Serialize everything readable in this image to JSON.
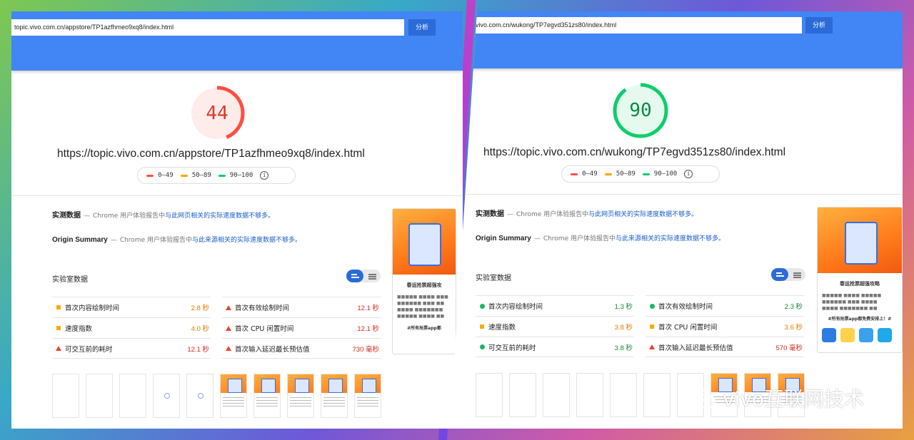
{
  "left": {
    "url_input": "topic.vivo.com.cn/appstore/TP1azfhmeo9xq8/index.html",
    "analyze_label": "分析",
    "score": "44",
    "score_color": "#ff4e42",
    "page_url": "https://topic.vivo.com.cn/appstore/TP1azfhmeo9xq8/index.html",
    "field_title": "实测数据",
    "field_dash": "—",
    "field_desc": "Chrome 用户体验报告中",
    "field_link": "与此网页相关的实际速度数据不够多。",
    "origin_title": "Origin Summary",
    "origin_dash": "—",
    "origin_desc": "Chrome 用户体验报告中",
    "origin_link": "与此来源相关的实际速度数据不够多。",
    "lab_title": "实验室数据",
    "metrics": [
      {
        "name": "首次内容绘制时间",
        "value": "2.8 秒",
        "status": "average",
        "color": "#e67700"
      },
      {
        "name": "首次有效绘制时间",
        "value": "12.1 秒",
        "status": "fail",
        "color": "#d02a1c"
      },
      {
        "name": "速度指数",
        "value": "4.0 秒",
        "status": "average",
        "color": "#e67700"
      },
      {
        "name": "首次 CPU 闲置时间",
        "value": "12.1 秒",
        "status": "fail",
        "color": "#d02a1c"
      },
      {
        "name": "可交互前的耗时",
        "value": "12.1 秒",
        "status": "fail",
        "color": "#d02a1c"
      },
      {
        "name": "首次输入延迟最长预估值",
        "value": "730 毫秒",
        "status": "fail",
        "color": "#d02a1c"
      }
    ],
    "preview_title": "春运抢票超强攻",
    "preview_footer": "#所有抢票app都"
  },
  "right": {
    "url_input": "vivo.com.cn/wukong/TP7egvd351zs80/index.html",
    "analyze_label": "分析",
    "score": "90",
    "score_color": "#0cce6b",
    "page_url": "https://topic.vivo.com.cn/wukong/TP7egvd351zs80/index.html",
    "field_title": "实测数据",
    "field_dash": "—",
    "field_desc": "Chrome 用户体验报告中",
    "field_link": "与此网页相关的实际速度数据不够多。",
    "origin_title": "Origin Summary",
    "origin_dash": "—",
    "origin_desc": "Chrome 用户体验报告中",
    "origin_link": "与此来源相关的实际速度数据不够多。",
    "lab_title": "实验室数据",
    "metrics": [
      {
        "name": "首次内容绘制时间",
        "value": "1.3 秒",
        "status": "pass",
        "color": "#178239"
      },
      {
        "name": "首次有效绘制时间",
        "value": "2.3 秒",
        "status": "pass",
        "color": "#178239"
      },
      {
        "name": "速度指数",
        "value": "3.8 秒",
        "status": "average",
        "color": "#e67700"
      },
      {
        "name": "首次 CPU 闲置时间",
        "value": "3.6 秒",
        "status": "average",
        "color": "#e67700"
      },
      {
        "name": "可交互前的耗时",
        "value": "3.8 秒",
        "status": "pass",
        "color": "#178239"
      },
      {
        "name": "首次输入延迟最长预估值",
        "value": "570 毫秒",
        "status": "fail",
        "color": "#d02a1c"
      }
    ],
    "preview_title": "春运抢票超强攻略",
    "preview_footer": "#所有抢票app都免费安排上！#"
  },
  "legend": {
    "fail": "0–49",
    "average": "50–89",
    "pass": "90–100"
  },
  "watermark": "vivo互联网技术"
}
